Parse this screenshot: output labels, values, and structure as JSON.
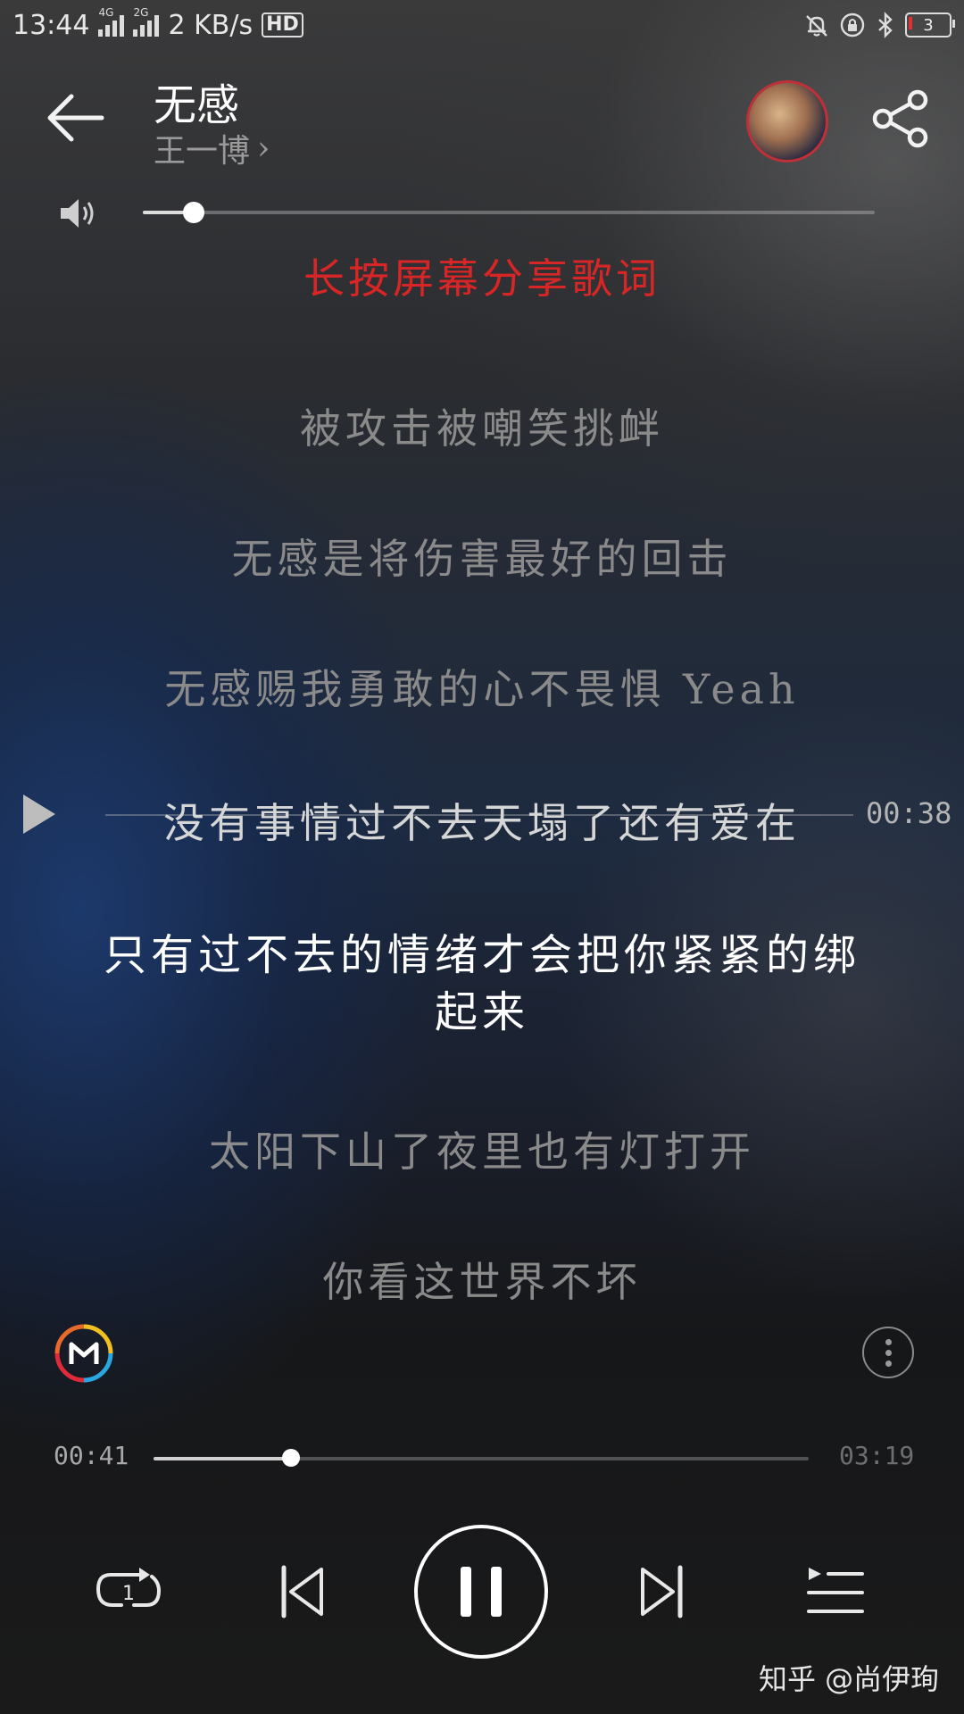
{
  "status_bar": {
    "time": "13:44",
    "signal_1_label": "4G",
    "signal_2_label": "2G",
    "network_speed": "2 KB/s",
    "hd_badge": "HD",
    "battery_level": "3"
  },
  "header": {
    "title": "无感",
    "artist": "王一博",
    "artist_chevron": "›"
  },
  "volume": {
    "level": 0.07
  },
  "share_hint": "长按屏幕分享歌词",
  "lyrics": [
    {
      "text": "被攻击被嘲笑挑衅",
      "state": "past"
    },
    {
      "text": "无感是将伤害最好的回击",
      "state": "past"
    },
    {
      "text": "无感赐我勇敢的心不畏惧 Yeah",
      "state": "past"
    },
    {
      "text": "没有事情过不去天塌了还有爱在",
      "state": "seek"
    },
    {
      "text": "只有过不去的情绪才会把你紧紧的绑起来",
      "state": "current"
    },
    {
      "text": "太阳下山了夜里也有灯打开",
      "state": "future"
    },
    {
      "text": "你看这世界不坏",
      "state": "future"
    }
  ],
  "seek": {
    "time": "00:38"
  },
  "playback": {
    "current_time": "00:41",
    "total_time": "03:19",
    "progress": 0.21
  },
  "controls": {
    "repeat_badge": "1"
  },
  "watermark": "知乎 @尚伊珣",
  "colors": {
    "accent_red": "#d82626",
    "lyric_dim": "#8a8a8a",
    "lyric_active": "#ffffff"
  },
  "icons": {
    "back": "arrow-left-icon",
    "share": "share-icon",
    "volume": "speaker-icon",
    "seek_play": "play-triangle-icon",
    "logo": "m-logo-icon",
    "more": "more-vertical-icon",
    "repeat": "repeat-one-icon",
    "prev": "skip-previous-icon",
    "pause": "pause-icon",
    "next": "skip-next-icon",
    "playlist": "playlist-icon"
  }
}
